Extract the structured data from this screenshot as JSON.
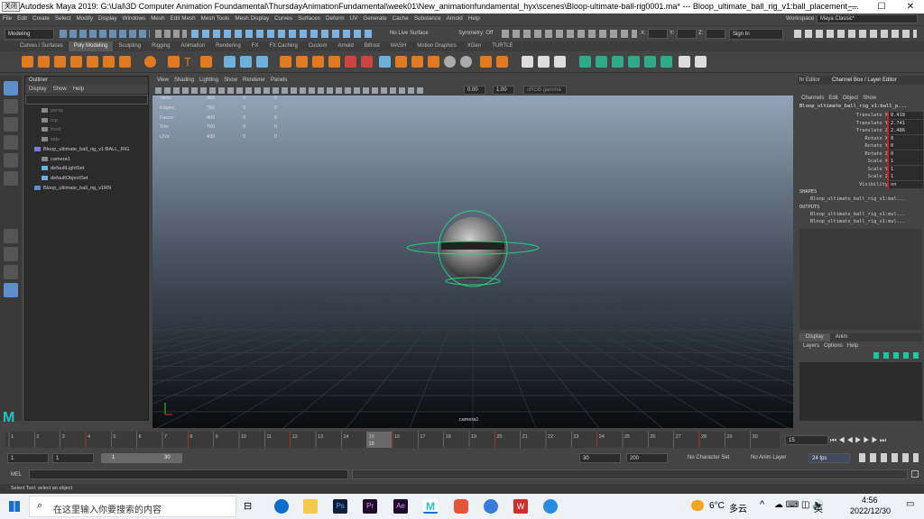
{
  "titlebar": {
    "tag": "关闭",
    "title": "Autodesk Maya 2019: G:\\Ual\\3D Computer Animation Foundamental\\ThursdayAnimationFundamental\\week01\\New_animationfundamental_hyx\\scenes\\Bloop-ultimate-ball-rig0001.ma*   ---   Bloop_ultimate_ball_rig_v1:ball_placement_...",
    "minimize": "—",
    "maximize": "☐",
    "close": "✕"
  },
  "menubar": [
    "File",
    "Edit",
    "Create",
    "Select",
    "Modify",
    "Display",
    "Windows",
    "Mesh",
    "Edit Mesh",
    "Mesh Tools",
    "Mesh Display",
    "Curves",
    "Surfaces",
    "Deform",
    "UV",
    "Generate",
    "Cache",
    "Substance",
    "Arnold",
    "Help"
  ],
  "workspace": {
    "label": "Workspace :",
    "value": "Maya Classic*"
  },
  "statusline": {
    "mode": "Modeling",
    "symmetry": "Symmetry: Off",
    "live_surface": "No Live Surface",
    "x_label": "X:",
    "y_label": "Y:",
    "z_label": "Z:",
    "sign_in": "Sign In"
  },
  "shelf_tabs": [
    "Curves / Surfaces",
    "Poly Modeling",
    "Sculpting",
    "Rigging",
    "Animation",
    "Rendering",
    "FX",
    "FX Caching",
    "Custom",
    "Arnold",
    "Bifrost",
    "MASH",
    "Motion Graphics",
    "XGen",
    "TURTLE"
  ],
  "shelf_active": 1,
  "outliner": {
    "title": "Outliner",
    "menu": [
      "Display",
      "Show",
      "Help"
    ],
    "items": [
      {
        "label": "persp",
        "dim": true,
        "icon": "camera-icon"
      },
      {
        "label": "top",
        "dim": true,
        "icon": "camera-icon"
      },
      {
        "label": "front",
        "dim": true,
        "icon": "camera-icon"
      },
      {
        "label": "side",
        "dim": true,
        "icon": "camera-icon"
      },
      {
        "label": "Bloop_ultimate_ball_rig_v1:BALL_RIG",
        "dim": false,
        "icon": "group-icon"
      },
      {
        "label": "camera1",
        "dim": false,
        "icon": "camera-icon"
      },
      {
        "label": "defaultLightSet",
        "dim": false,
        "icon": "set-icon"
      },
      {
        "label": "defaultObjectSet",
        "dim": false,
        "icon": "set-icon"
      },
      {
        "label": "Bloop_ultimate_ball_rig_v1RN",
        "dim": false,
        "icon": "reference-icon"
      }
    ]
  },
  "viewport": {
    "menu": [
      "View",
      "Shading",
      "Lighting",
      "Show",
      "Renderer",
      "Panels"
    ],
    "exposure": "0.00",
    "gamma": "1.00",
    "colorspace": "sRGB gamma",
    "hud_rows": [
      {
        "label": "Verts:",
        "a": "382",
        "b": "0",
        "c": "0"
      },
      {
        "label": "Edges:",
        "a": "760",
        "b": "0",
        "c": "0"
      },
      {
        "label": "Faces:",
        "a": "400",
        "b": "0",
        "c": "0"
      },
      {
        "label": "Tris:",
        "a": "760",
        "b": "0",
        "c": "0"
      },
      {
        "label": "UVs:",
        "a": "439",
        "b": "0",
        "c": "0"
      }
    ],
    "camera_label": "camera1"
  },
  "channelbox": {
    "tabs": [
      "hr Editor",
      "Channel Box / Layer Editor"
    ],
    "menu": [
      "Channels",
      "Edit",
      "Object",
      "Show"
    ],
    "object": "Bloop_ultimate_ball_rig_v1:ball_p...",
    "channels": [
      {
        "name": "Translate X",
        "value": "0.418"
      },
      {
        "name": "Translate Y",
        "value": "2.741"
      },
      {
        "name": "Translate Z",
        "value": "2.486"
      },
      {
        "name": "Rotate X",
        "value": "0"
      },
      {
        "name": "Rotate Y",
        "value": "0"
      },
      {
        "name": "Rotate Z",
        "value": "0"
      },
      {
        "name": "Scale X",
        "value": "1"
      },
      {
        "name": "Scale Y",
        "value": "1"
      },
      {
        "name": "Scale Z",
        "value": "1"
      },
      {
        "name": "Visibility",
        "value": "on"
      }
    ],
    "shapes_label": "SHAPES",
    "shapes_item": "Bloop_ultimate_ball_rig_v1:bal...",
    "outputs_label": "OUTPUTS",
    "outputs_items": [
      "Bloop_ultimate_ball_rig_v1:mul...",
      "Bloop_ultimate_ball_rig_v1:mul..."
    ],
    "layer_tabs": [
      "Display",
      "Anim"
    ],
    "layer_menu": [
      "Layers",
      "Options",
      "Help"
    ]
  },
  "timeline": {
    "ticks": [
      "1",
      "2",
      "3",
      "4",
      "5",
      "6",
      "7",
      "8",
      "9",
      "10",
      "11",
      "12",
      "13",
      "14",
      "15",
      "16",
      "17",
      "18",
      "19",
      "20",
      "21",
      "22",
      "23",
      "24",
      "25",
      "26",
      "27",
      "28",
      "29",
      "30"
    ],
    "current_frame": "15",
    "current_frame_field": "15"
  },
  "range": {
    "start": "1",
    "playback_start": "1",
    "slider_start": "1",
    "slider_end": "30",
    "playback_end": "30",
    "end": "200",
    "character_set": "No Character Set",
    "anim_layer": "No Anim Layer",
    "fps": "24 fps"
  },
  "cmdline": {
    "label": "MEL"
  },
  "helpline": "Select Tool: select an object",
  "taskbar": {
    "search_placeholder": "在这里输入你要搜索的内容",
    "temperature": "6°C",
    "weather": "多云",
    "ime": "英",
    "time": "4:56",
    "date": "2022/12/30"
  },
  "colors": {
    "accent_red": "#cc2222",
    "rig_green": "#28d07a",
    "maya_teal": "#22c3c3"
  }
}
